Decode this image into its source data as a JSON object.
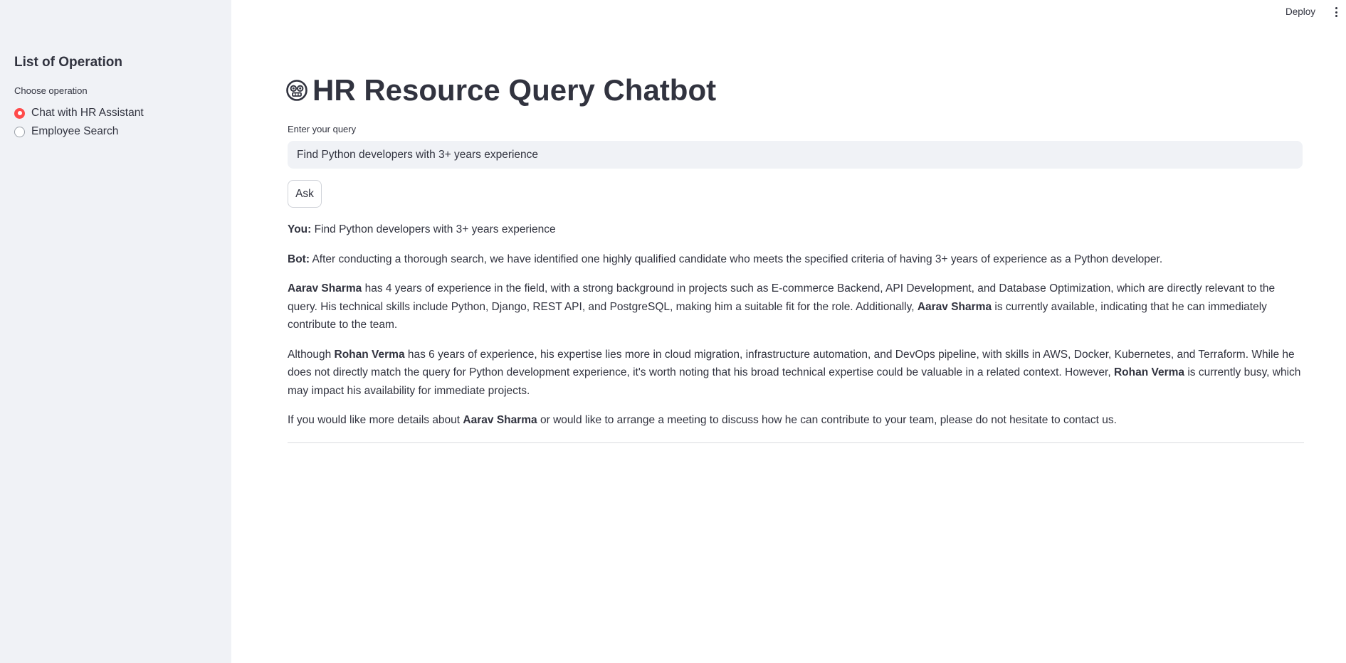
{
  "sidebar": {
    "title": "List of Operation",
    "radio_label": "Choose operation",
    "options": [
      {
        "label": "Chat with HR Assistant",
        "selected": true
      },
      {
        "label": "Employee Search",
        "selected": false
      }
    ]
  },
  "header": {
    "deploy_label": "Deploy",
    "menu_icon": "kebab-menu-icon"
  },
  "main": {
    "title": "HR Resource Query Chatbot",
    "title_icon": "robot-face-icon",
    "query_label": "Enter your query",
    "query_value": "Find Python developers with 3+ years experience",
    "ask_label": "Ask",
    "chat": {
      "you_label": "You:",
      "you_text": "Find Python developers with 3+ years experience",
      "bot_label": "Bot:",
      "bot_text": "After conducting a thorough search, we have identified one highly qualified candidate who meets the specified criteria of having 3+ years of experience as a Python developer.",
      "p2": {
        "name1": "Aarav Sharma",
        "text1": " has 4 years of experience in the field, with a strong background in projects such as E-commerce Backend, API Development, and Database Optimization, which are directly relevant to the query. His technical skills include Python, Django, REST API, and PostgreSQL, making him a suitable fit for the role. Additionally, ",
        "name2": "Aarav Sharma",
        "text2": " is currently available, indicating that he can immediately contribute to the team."
      },
      "p3": {
        "text0": "Although ",
        "name1": "Rohan Verma",
        "text1": " has 6 years of experience, his expertise lies more in cloud migration, infrastructure automation, and DevOps pipeline, with skills in AWS, Docker, Kubernetes, and Terraform. While he does not directly match the query for Python development experience, it's worth noting that his broad technical expertise could be valuable in a related context. However, ",
        "name2": "Rohan Verma",
        "text2": " is currently busy, which may impact his availability for immediate projects."
      },
      "p4": {
        "text0": "If you would like more details about ",
        "name1": "Aarav Sharma",
        "text1": " or would like to arrange a meeting to discuss how he can contribute to your team, please do not hesitate to contact us."
      }
    }
  },
  "colors": {
    "accent": "#ff4b4b",
    "sidebar_bg": "#f0f2f6",
    "text": "#31333f"
  }
}
